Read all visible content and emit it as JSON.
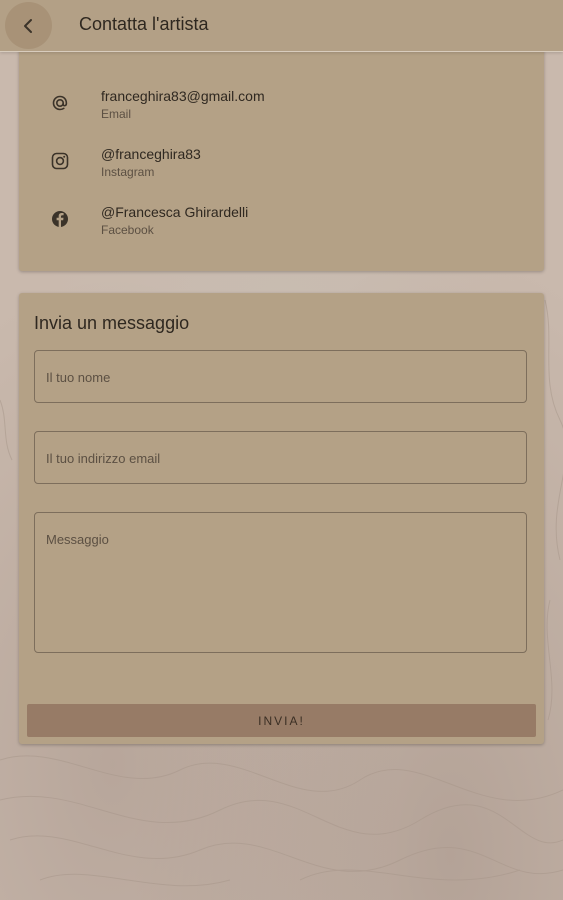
{
  "header": {
    "title": "Contatta l'artista",
    "back_icon": "arrow-back-icon"
  },
  "contacts": [
    {
      "icon": "at-sign-icon",
      "value": "franceghira83@gmail.com",
      "label": "Email"
    },
    {
      "icon": "instagram-icon",
      "value": "@franceghira83",
      "label": "Instagram"
    },
    {
      "icon": "facebook-icon",
      "value": "@Francesca Ghirardelli",
      "label": "Facebook"
    }
  ],
  "form": {
    "title": "Invia un messaggio",
    "name_placeholder": "Il tuo nome",
    "email_placeholder": "Il tuo indirizzo email",
    "message_placeholder": "Messaggio",
    "send_label": "INVIA!"
  },
  "colors": {
    "card": "#b4a186",
    "button": "#977b66",
    "background": "#c9b9ad"
  }
}
